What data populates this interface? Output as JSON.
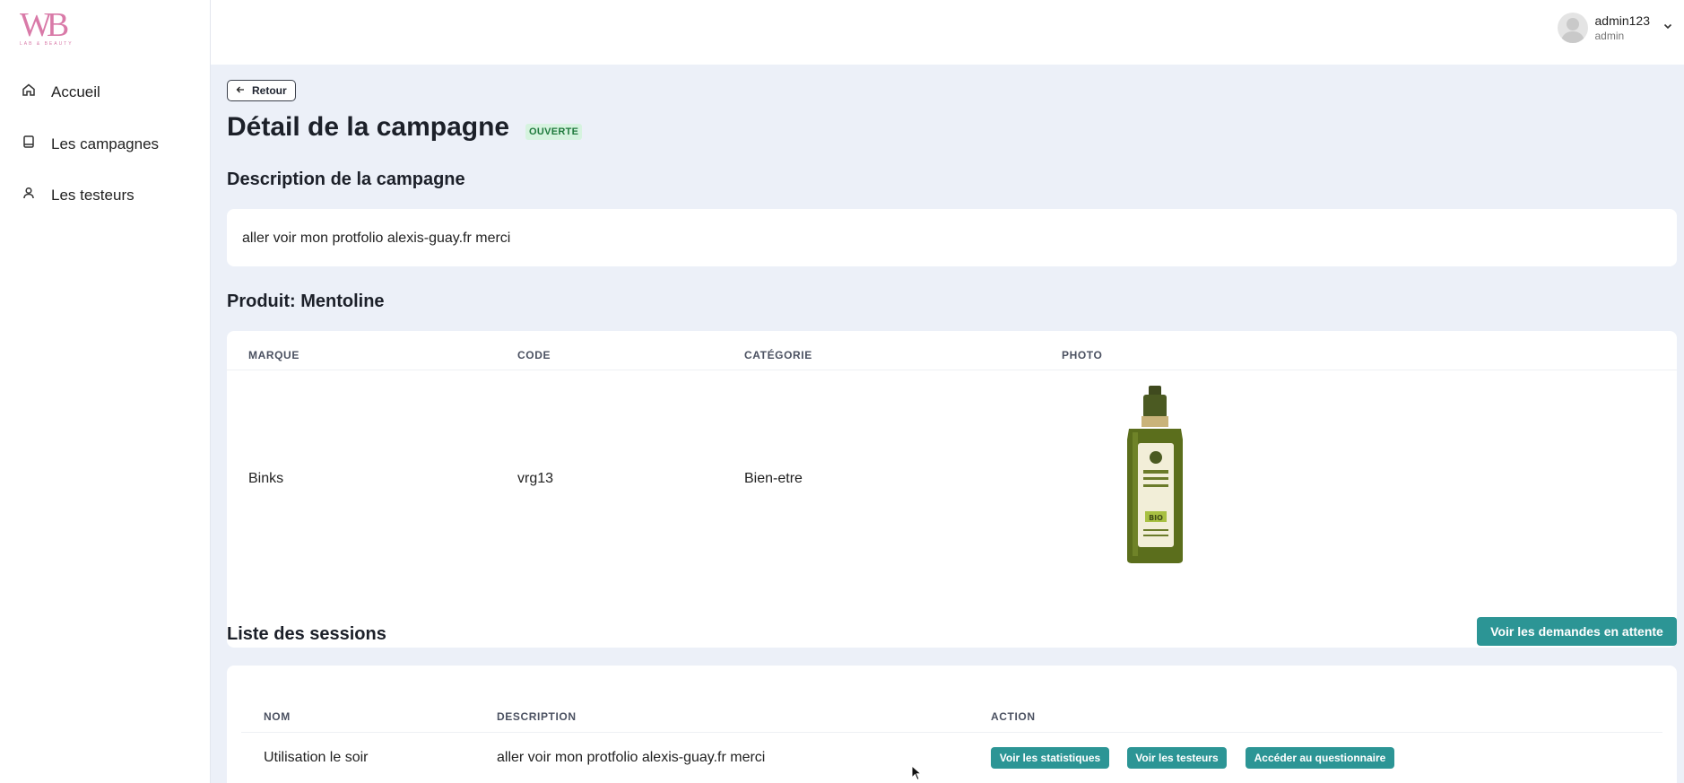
{
  "brand": {
    "logo_text": "WB",
    "logo_sub": "LAB & BEAUTY",
    "accent": "#d97aa8"
  },
  "sidebar": {
    "items": [
      {
        "label": "Accueil",
        "icon": "home-icon"
      },
      {
        "label": "Les campagnes",
        "icon": "book-icon"
      },
      {
        "label": "Les testeurs",
        "icon": "user-icon"
      }
    ]
  },
  "header": {
    "user_name": "admin123",
    "user_role": "admin"
  },
  "page": {
    "back_label": "Retour",
    "title": "Détail de la campagne",
    "status": "OUVERTE",
    "description_title": "Description de la campagne",
    "description_text": "aller voir mon protfolio alexis-guay.fr merci"
  },
  "product": {
    "title": "Produit: Mentoline",
    "columns": [
      "MARQUE",
      "CODE",
      "CATÉGORIE",
      "PHOTO"
    ],
    "row": {
      "marque": "Binks",
      "code": "vrg13",
      "categorie": "Bien-etre",
      "photo_label": "BIO"
    }
  },
  "sessions": {
    "title": "Liste des sessions",
    "pending_button": "Voir les demandes en attente",
    "columns": [
      "NOM",
      "DESCRIPTION",
      "ACTION"
    ],
    "rows": [
      {
        "nom": "Utilisation le soir",
        "description": "aller voir mon protfolio alexis-guay.fr merci",
        "actions": [
          "Voir les statistiques",
          "Voir les testeurs",
          "Accéder au questionnaire"
        ]
      }
    ]
  },
  "colors": {
    "teal": "#2c9595",
    "background": "#ecf0f8",
    "badge_bg": "#d6f3df",
    "badge_text": "#1f7a3d"
  }
}
